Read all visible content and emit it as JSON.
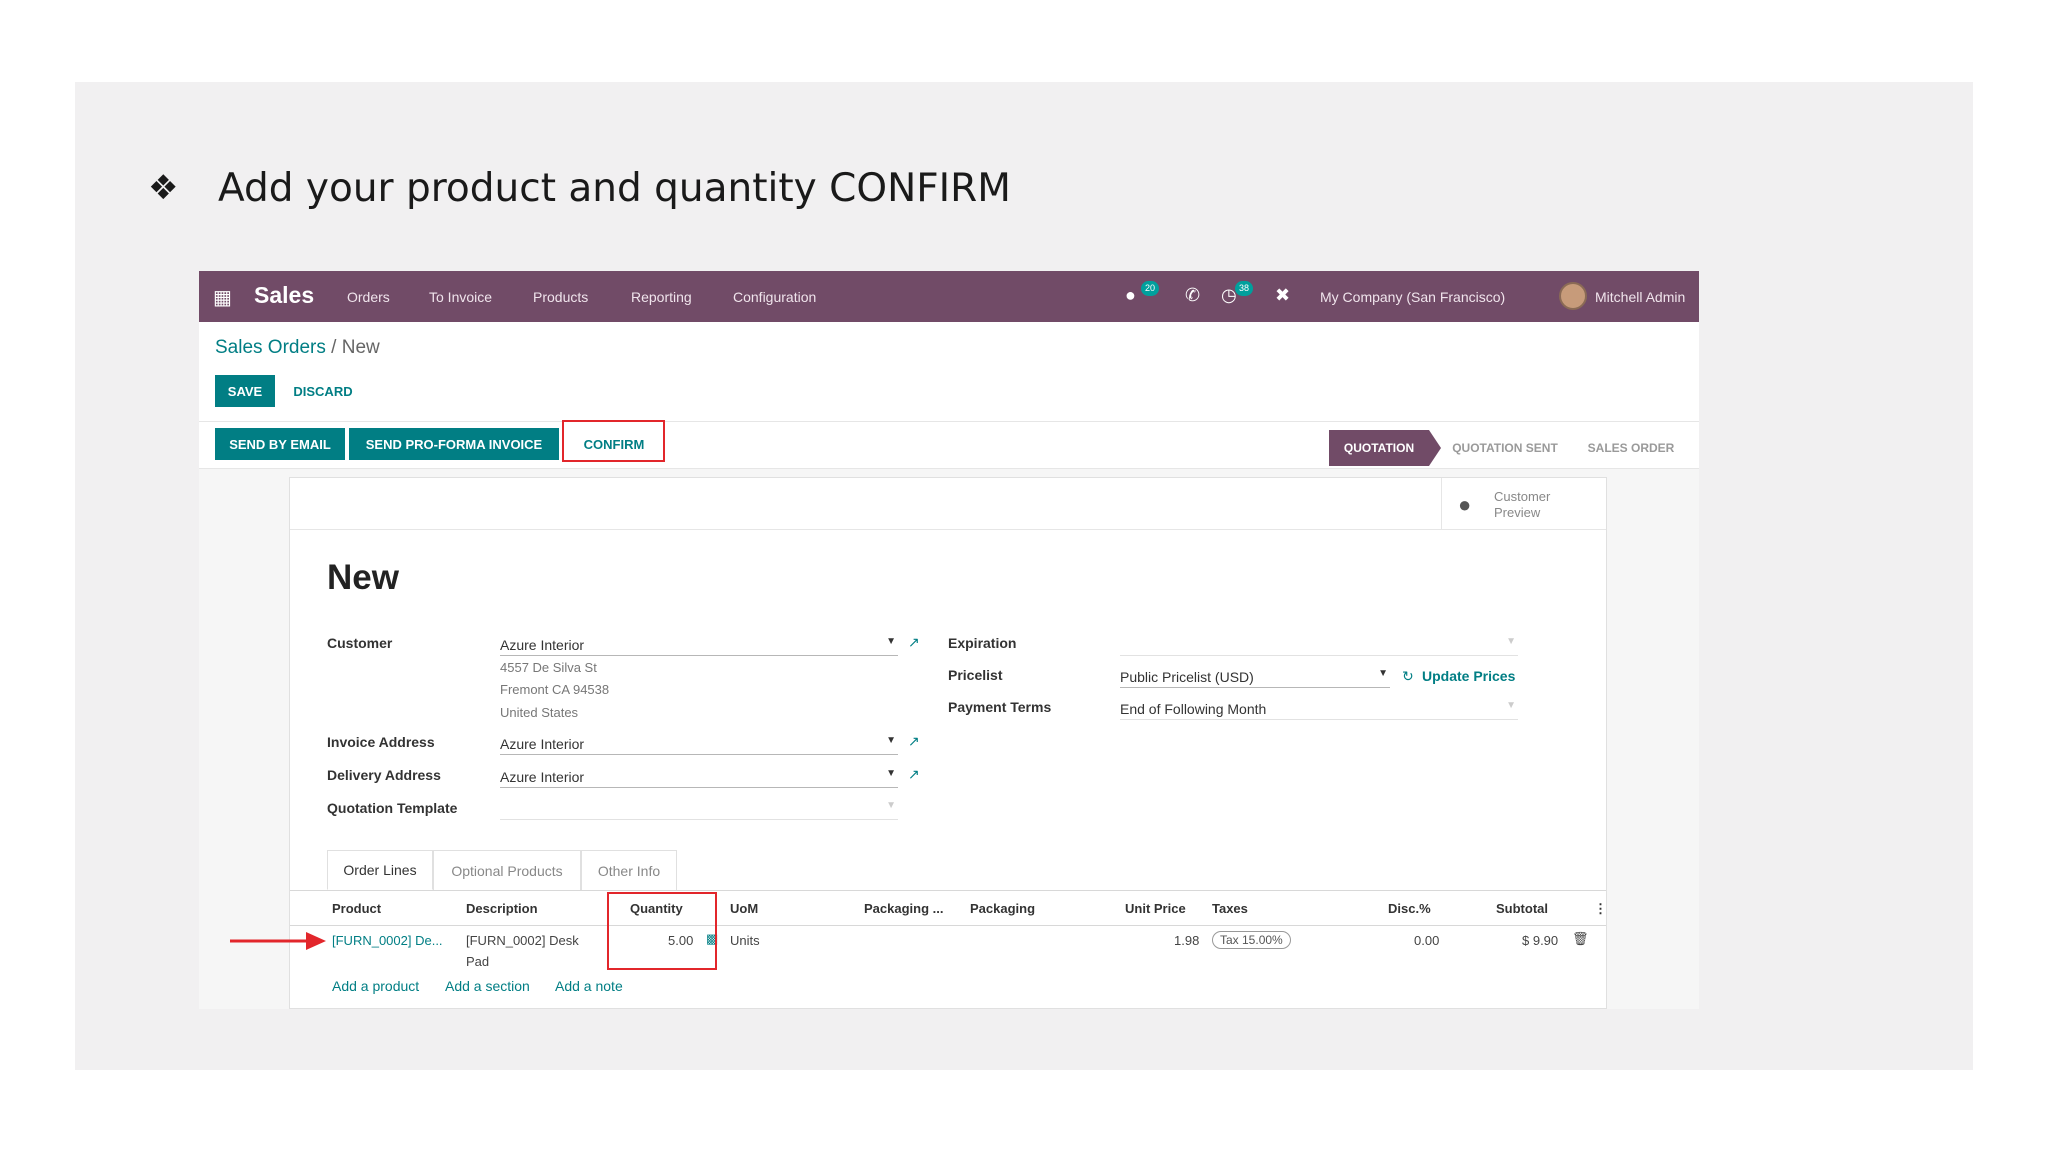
{
  "slide": {
    "bullet": "❖",
    "heading": "Add your product and quantity CONFIRM"
  },
  "navbar": {
    "app_name": "Sales",
    "menu": [
      "Orders",
      "To Invoice",
      "Products",
      "Reporting",
      "Configuration"
    ],
    "messages_badge": "20",
    "activity_badge": "38",
    "company": "My Company (San Francisco)",
    "user": "Mitchell Admin"
  },
  "breadcrumb": {
    "parent": "Sales Orders",
    "separator": "/",
    "current": "New"
  },
  "buttons": {
    "save": "SAVE",
    "discard": "DISCARD",
    "send_email": "SEND BY EMAIL",
    "proforma": "SEND PRO-FORMA INVOICE",
    "confirm": "CONFIRM"
  },
  "stages": [
    "QUOTATION",
    "QUOTATION SENT",
    "SALES ORDER"
  ],
  "preview": {
    "label": "Customer Preview"
  },
  "form": {
    "title": "New",
    "customer_label": "Customer",
    "customer_value": "Azure Interior",
    "address_line1": "4557 De Silva St",
    "address_line2": "Fremont CA 94538",
    "address_line3": "United States",
    "invoice_label": "Invoice Address",
    "invoice_value": "Azure Interior",
    "delivery_label": "Delivery Address",
    "delivery_value": "Azure Interior",
    "template_label": "Quotation Template",
    "expiration_label": "Expiration",
    "pricelist_label": "Pricelist",
    "pricelist_value": "Public Pricelist (USD)",
    "update_prices": "Update Prices",
    "payment_label": "Payment Terms",
    "payment_value": "End of Following Month"
  },
  "tabs": [
    "Order Lines",
    "Optional Products",
    "Other Info"
  ],
  "table": {
    "headers": [
      "Product",
      "Description",
      "Quantity",
      "UoM",
      "Packaging ...",
      "Packaging",
      "Unit Price",
      "Taxes",
      "Disc.%",
      "Subtotal"
    ],
    "row": {
      "product": "[FURN_0002] De...",
      "description_1": "[FURN_0002] Desk",
      "description_2": "Pad",
      "quantity": "5.00",
      "uom": "Units",
      "unit_price": "1.98",
      "tax": "Tax 15.00%",
      "discount": "0.00",
      "subtotal": "$ 9.90"
    },
    "add_links": [
      "Add a product",
      "Add a section",
      "Add a note"
    ]
  },
  "colors": {
    "brand": "#714b67",
    "primary": "#017e84",
    "highlight": "#e2262b"
  }
}
